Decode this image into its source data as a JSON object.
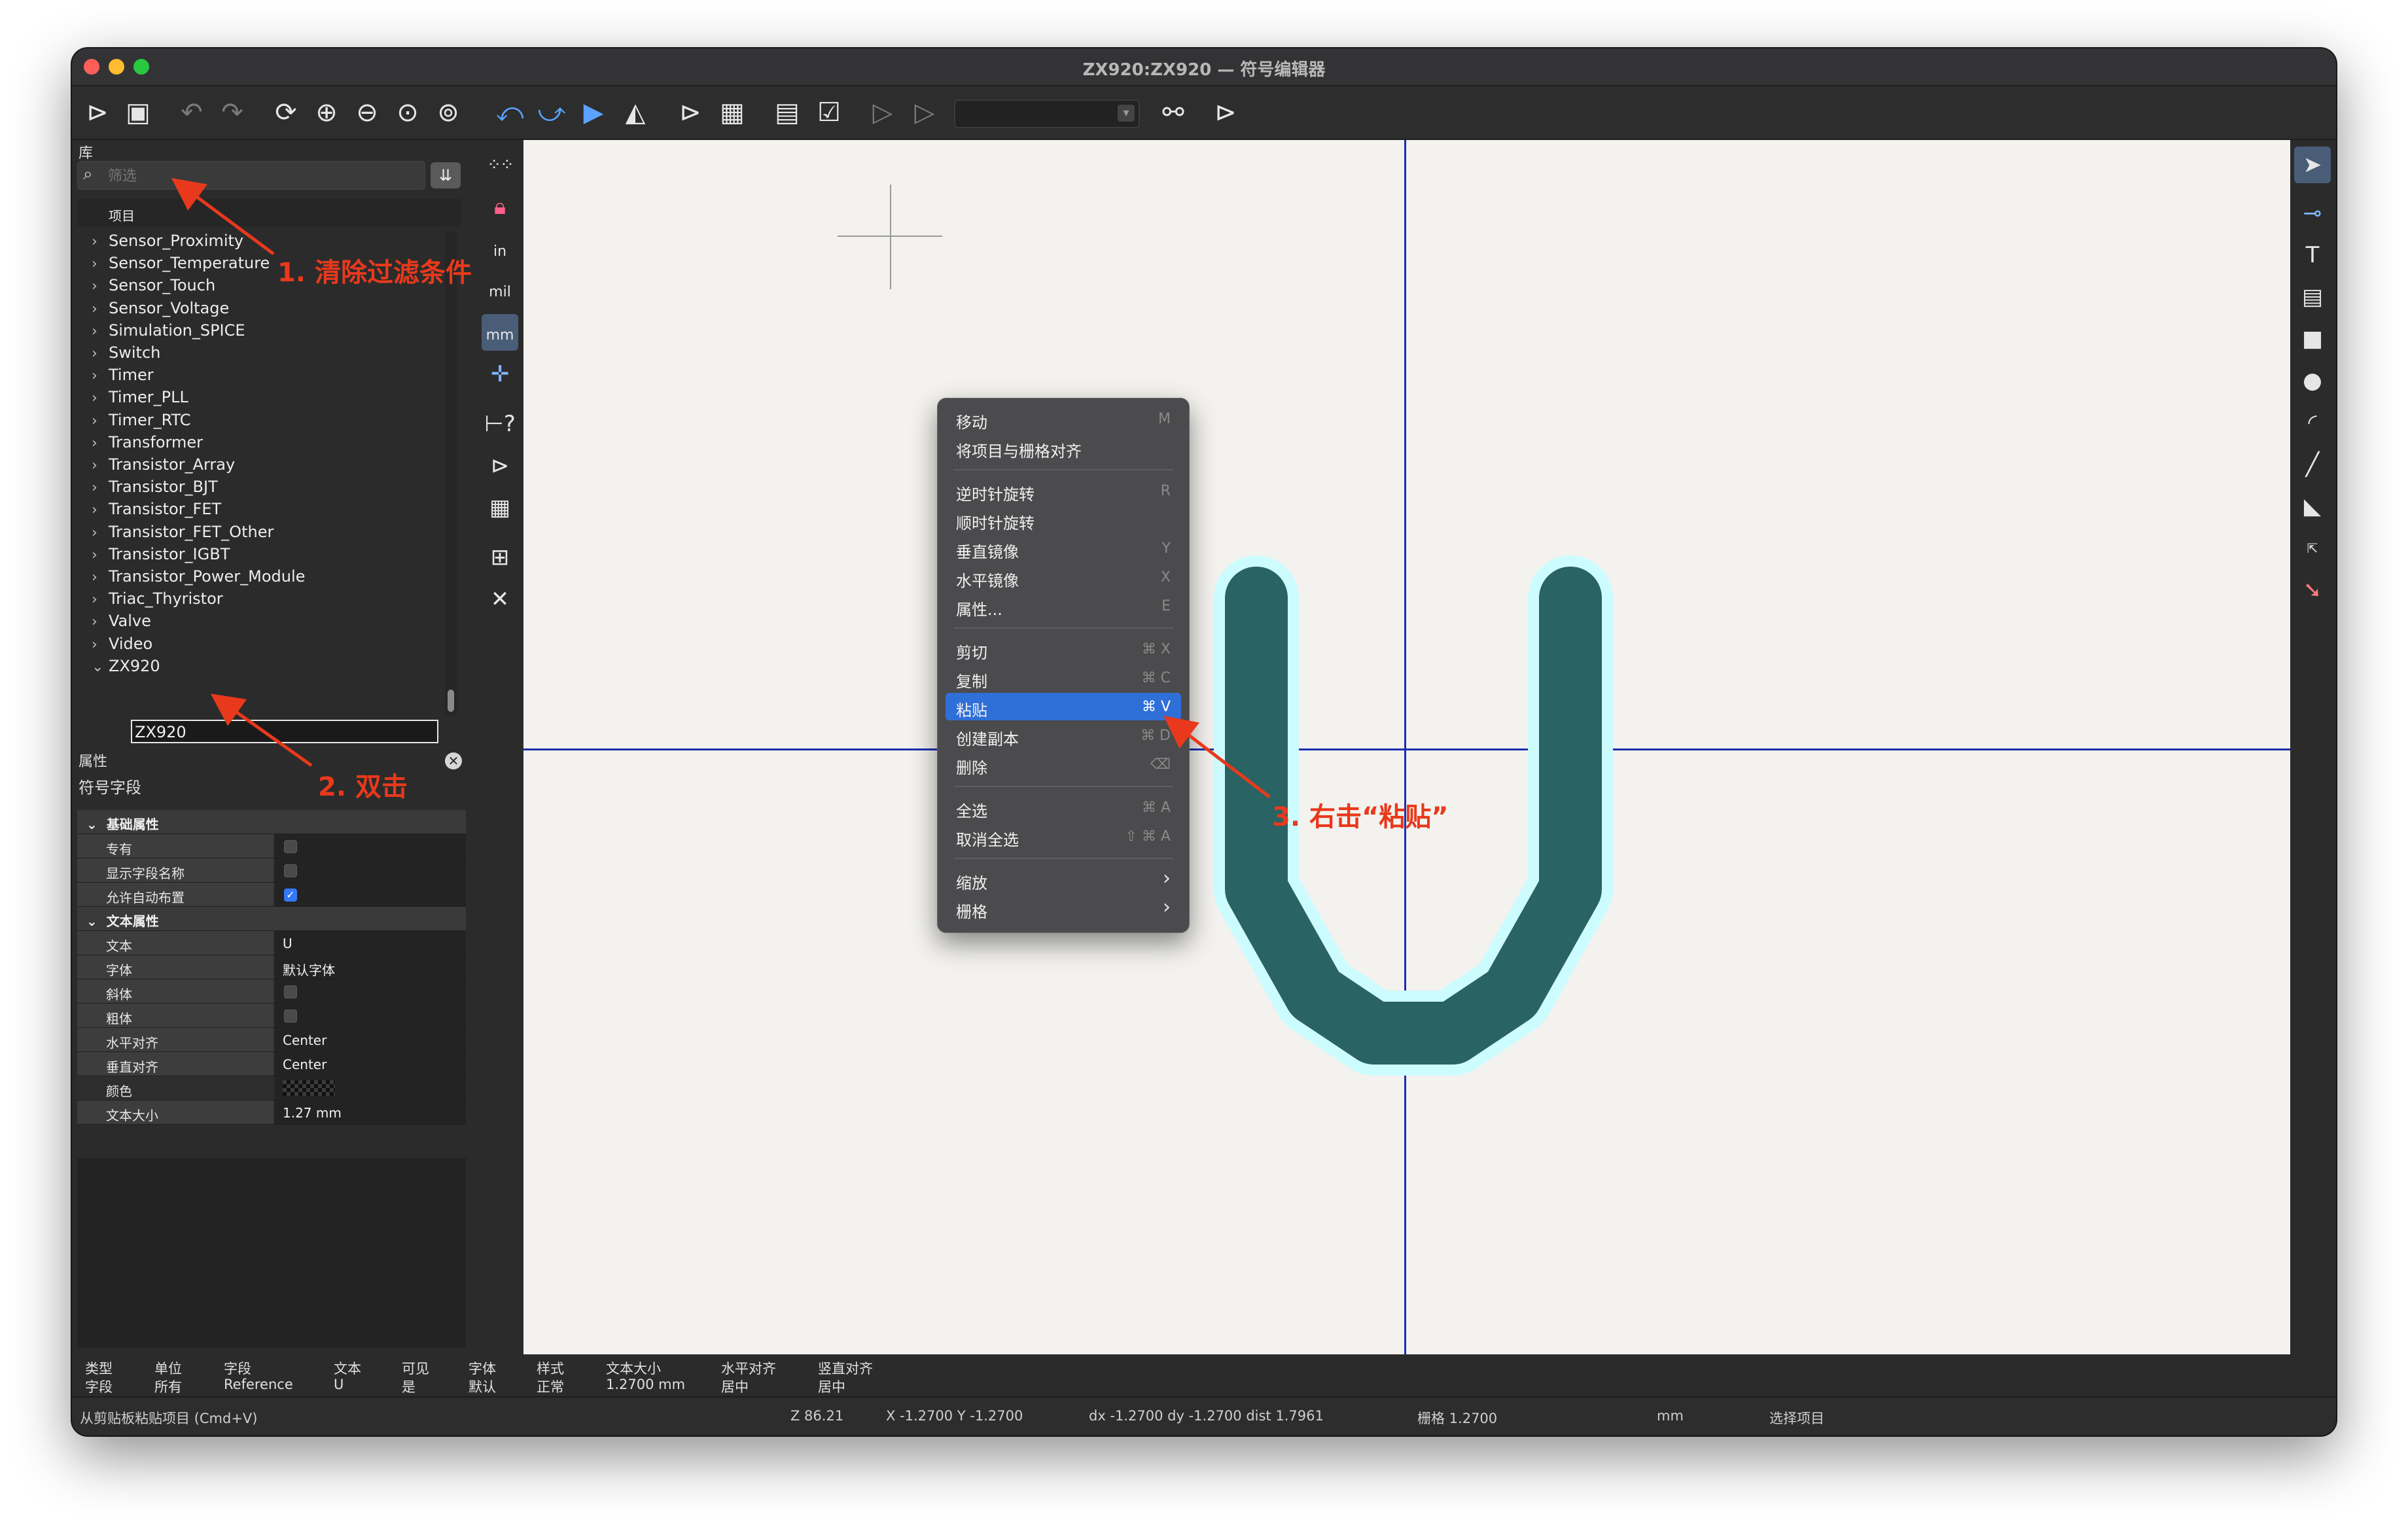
{
  "window": {
    "title": "ZX920:ZX920 — 符号编辑器",
    "traffic_colors": [
      "#fe5f57",
      "#febc2e",
      "#28c840"
    ]
  },
  "toolbar": {
    "icons": [
      "new-symbol-icon",
      "save-icon",
      "undo-icon",
      "redo-icon",
      "refresh-icon",
      "zoom-in-icon",
      "zoom-out-icon",
      "zoom-fit-icon",
      "zoom-selection-icon",
      "rotate-ccw-icon",
      "rotate-cw-icon",
      "mirror-v-icon",
      "mirror-h-icon",
      "symbol-properties-icon",
      "pin-table-icon",
      "datasheet-icon",
      "symbol-checker-icon",
      "body-style-1-icon",
      "body-style-2-icon",
      "unit-selector",
      "sync-pins-icon",
      "export-symbol-icon"
    ]
  },
  "library": {
    "panel_title": "库",
    "search_placeholder": "筛选",
    "column_header": "项目",
    "items": [
      "Sensor_Proximity",
      "Sensor_Temperature",
      "Sensor_Touch",
      "Sensor_Voltage",
      "Simulation_SPICE",
      "Switch",
      "Timer",
      "Timer_PLL",
      "Timer_RTC",
      "Transformer",
      "Transistor_Array",
      "Transistor_BJT",
      "Transistor_FET",
      "Transistor_FET_Other",
      "Transistor_IGBT",
      "Transistor_Power_Module",
      "Triac_Thyristor",
      "Valve",
      "Video",
      "ZX920"
    ],
    "expanded_item": "ZX920",
    "child_edit_value": "ZX920"
  },
  "properties": {
    "panel_title": "属性",
    "subtitle": "符号字段",
    "section_basic": "基础属性",
    "private_label": "专有",
    "private_checked": false,
    "show_field_name_label": "显示字段名称",
    "show_field_name_checked": false,
    "allow_autoplace_label": "允许自动布置",
    "allow_autoplace_checked": true,
    "section_text": "文本属性",
    "text_label": "文本",
    "text_value": "U",
    "font_label": "字体",
    "font_value": "默认字体",
    "italic_label": "斜体",
    "italic_checked": false,
    "bold_label": "粗体",
    "bold_checked": false,
    "h_align_label": "水平对齐",
    "h_align_value": "Center",
    "v_align_label": "垂直对齐",
    "v_align_value": "Center",
    "color_label": "颜色",
    "text_size_label": "文本大小",
    "text_size_value": "1.27 mm"
  },
  "left_tools": {
    "units_in": "in",
    "units_mil": "mil",
    "units_mm": "mm"
  },
  "context_menu": {
    "items": [
      {
        "label": "移动",
        "shortcut": "M",
        "highlight": false
      },
      {
        "label": "将项目与栅格对齐",
        "shortcut": "",
        "highlight": false
      },
      {
        "label": "逆时针旋转",
        "shortcut": "R",
        "highlight": false
      },
      {
        "label": "顺时针旋转",
        "shortcut": "",
        "highlight": false
      },
      {
        "label": "垂直镜像",
        "shortcut": "Y",
        "highlight": false
      },
      {
        "label": "水平镜像",
        "shortcut": "X",
        "highlight": false
      },
      {
        "label": "属性...",
        "shortcut": "E",
        "highlight": false
      },
      {
        "label": "剪切",
        "shortcut": "⌘ X",
        "highlight": false
      },
      {
        "label": "复制",
        "shortcut": "⌘ C",
        "highlight": false
      },
      {
        "label": "粘贴",
        "shortcut": "⌘ V",
        "highlight": true
      },
      {
        "label": "创建副本",
        "shortcut": "⌘ D",
        "highlight": false
      },
      {
        "label": "删除",
        "shortcut": "⌫",
        "highlight": false
      },
      {
        "label": "全选",
        "shortcut": "⌘ A",
        "highlight": false
      },
      {
        "label": "取消全选",
        "shortcut": "⇧ ⌘ A",
        "highlight": false
      },
      {
        "label": "缩放",
        "shortcut": "›",
        "highlight": false
      },
      {
        "label": "栅格",
        "shortcut": "›",
        "highlight": false
      }
    ]
  },
  "annotations": {
    "step1": "1. 清除过滤条件",
    "step2": "2. 双击",
    "step3": "3. 右击“粘贴”",
    "color": "#e8391c"
  },
  "symbol": {
    "glyph": "U",
    "fill_color": "#296363",
    "highlight_color": "#cdfcff"
  },
  "message_panel": {
    "col1_head": "类型",
    "col1_val": "字段",
    "col2_head": "单位",
    "col2_val": "所有",
    "col3_head": "字段",
    "col3_val": "Reference",
    "col4_head": "文本",
    "col4_val": "U",
    "col5_head": "可见",
    "col5_val": "是",
    "col6_head": "字体",
    "col6_val": "默认",
    "col7_head": "样式",
    "col7_val": "正常",
    "col8_head": "文本大小",
    "col8_val": "1.2700 mm",
    "col9_head": "水平对齐",
    "col9_val": "居中",
    "col10_head": "竖直对齐",
    "col10_val": "居中"
  },
  "statusbar": {
    "message": "从剪贴板粘贴项目 (Cmd+V)",
    "zoom": "Z 86.21",
    "xy": "X -1.2700  Y -1.2700",
    "delta": "dx -1.2700  dy -1.2700  dist 1.7961",
    "grid": "栅格 1.2700",
    "units": "mm",
    "mode": "选择项目"
  },
  "colors": {
    "accent_blue": "#2f6fd8",
    "axis_blue": "#1a2fb0",
    "canvas_bg": "#f3f2ee"
  }
}
